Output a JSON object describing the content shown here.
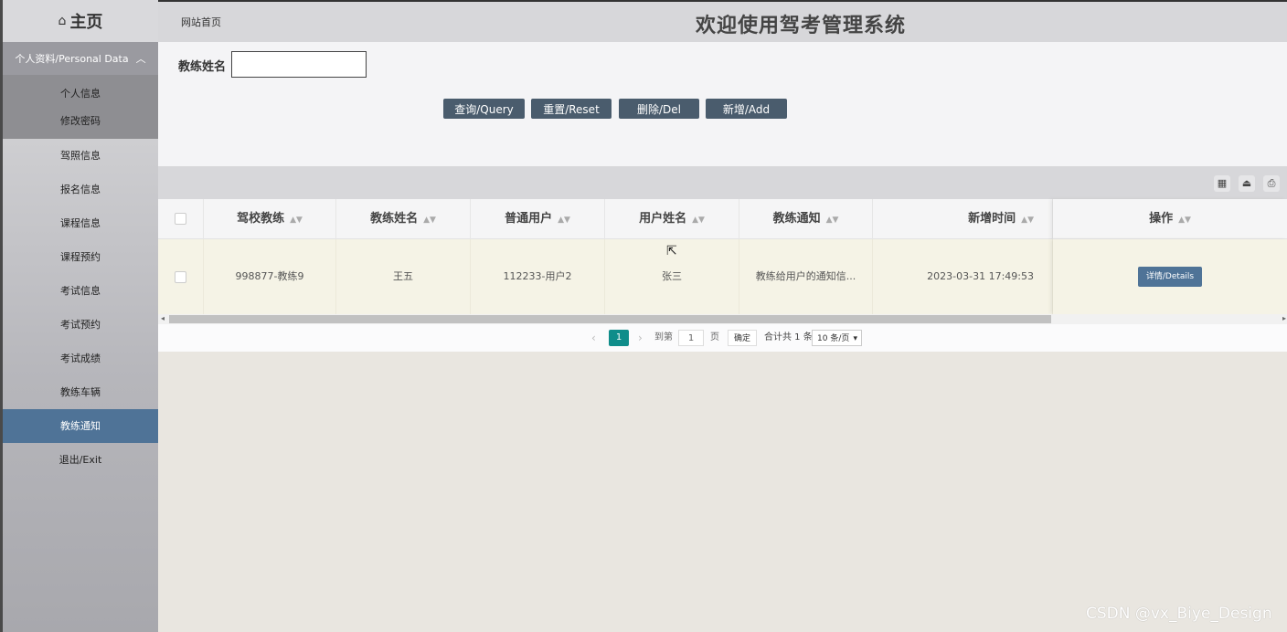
{
  "sidebar": {
    "home_label": "主页",
    "group_label": "个人资料/Personal Data",
    "sub_items": [
      "个人信息",
      "修改密码"
    ],
    "items": [
      "驾照信息",
      "报名信息",
      "课程信息",
      "课程预约",
      "考试信息",
      "考试预约",
      "考试成绩",
      "教练车辆",
      "教练通知",
      "退出/Exit"
    ],
    "active_item": "教练通知"
  },
  "header": {
    "breadcrumb": "网站首页",
    "title": "欢迎使用驾考管理系统"
  },
  "search": {
    "label": "教练姓名",
    "value": "",
    "buttons": {
      "query": "查询/Query",
      "reset": "重置/Reset",
      "delete": "删除/Del",
      "add": "新增/Add"
    }
  },
  "table": {
    "columns": [
      "驾校教练",
      "教练姓名",
      "普通用户",
      "用户姓名",
      "教练通知",
      "新增时间",
      "操作"
    ],
    "rows": [
      {
        "coach": "998877-教练9",
        "coach_name": "王五",
        "user": "112233-用户2",
        "user_name": "张三",
        "notice": "教练给用户的通知信...",
        "created": "2023-03-31 17:49:53",
        "action": "详情/Details"
      }
    ]
  },
  "pager": {
    "current": "1",
    "goto_label": "到第",
    "goto_value": "1",
    "page_unit": "页",
    "confirm": "确定",
    "total": "合计共 1 条",
    "page_size": "10 条/页"
  },
  "icons": {
    "home": "home-icon",
    "collapse": "chevron-up-icon",
    "columns": "grid-icon",
    "export": "export-icon",
    "print": "print-icon",
    "sort": "sort-icon"
  },
  "colors": {
    "active_nav": "#4f7397",
    "button": "#4a5c6d",
    "pager_current": "#0f8d8a",
    "row_bg": "#f5f3e6"
  },
  "watermark": "CSDN @vx_Biye_Design"
}
